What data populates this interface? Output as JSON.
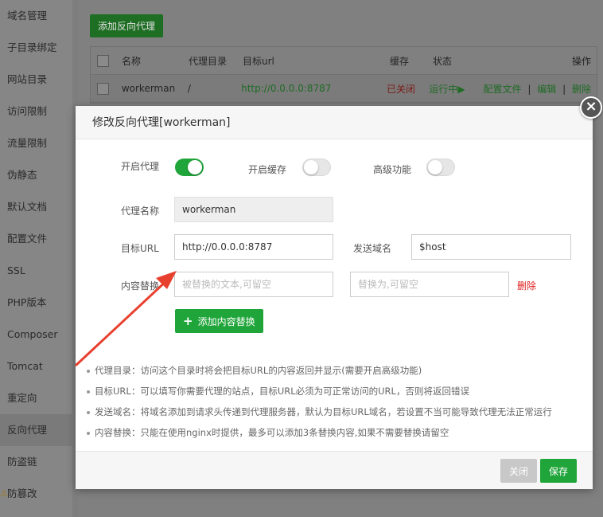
{
  "sidebar": {
    "items": [
      {
        "label": "域名管理"
      },
      {
        "label": "子目录绑定"
      },
      {
        "label": "网站目录"
      },
      {
        "label": "访问限制"
      },
      {
        "label": "流量限制"
      },
      {
        "label": "伪静态"
      },
      {
        "label": "默认文档"
      },
      {
        "label": "配置文件"
      },
      {
        "label": "SSL"
      },
      {
        "label": "PHP版本"
      },
      {
        "label": "Composer"
      },
      {
        "label": "Tomcat"
      },
      {
        "label": "重定向"
      },
      {
        "label": "反向代理"
      },
      {
        "label": "防盗链"
      },
      {
        "label": "防篡改"
      }
    ],
    "active": "反向代理"
  },
  "background": {
    "add_proxy_label": "添加反向代理",
    "table": {
      "headers": {
        "name": "名称",
        "dir": "代理目录",
        "url": "目标url",
        "cache": "缓存",
        "status": "状态",
        "ops": "操作"
      },
      "rows": [
        {
          "name": "workerman",
          "dir": "/",
          "url": "http://0.0.0.0:8787",
          "cache": "已关闭",
          "status": "运行中▶",
          "op_config": "配置文件",
          "sep1": "|",
          "op_edit": "编辑",
          "sep2": "|",
          "op_delete": "删除"
        }
      ]
    }
  },
  "modal": {
    "title": "修改反向代理[workerman]",
    "close_symbol": "×",
    "toggles": {
      "proxy_label": "开启代理",
      "proxy_on": true,
      "cache_label": "开启缓存",
      "cache_on": false,
      "advanced_label": "高级功能",
      "advanced_on": false
    },
    "proxy_name_label": "代理名称",
    "proxy_name_value": "workerman",
    "target_url_label": "目标URL",
    "target_url_value": "http://0.0.0.0:8787",
    "send_domain_label": "发送域名",
    "send_domain_value": "$host",
    "content_replace_label": "内容替换",
    "replace_from_placeholder": "被替换的文本,可留空",
    "replace_to_placeholder": "替换为,可留空",
    "delete_label": "删除",
    "add_content_label": "添加内容替换",
    "notes": [
      "代理目录：访问这个目录时将会把目标URL的内容返回并显示(需要开启高级功能)",
      "目标URL：可以填写你需要代理的站点，目标URL必须为可正常访问的URL，否则将返回错误",
      "发送域名：将域名添加到请求头传递到代理服务器，默认为目标URL域名，若设置不当可能导致代理无法正常运行",
      "内容替换：只能在使用nginx时提供，最多可以添加3条替换内容,如果不需要替换请留空"
    ],
    "footer": {
      "close_label": "关闭",
      "save_label": "保存"
    }
  },
  "colors": {
    "accent": "#20a53a",
    "danger": "#e02020",
    "annotation_arrow": "#e8402f"
  }
}
